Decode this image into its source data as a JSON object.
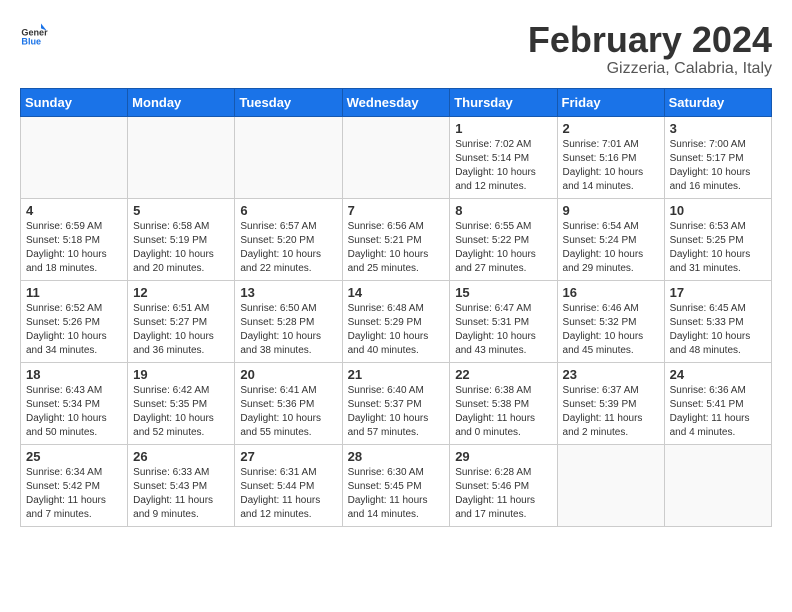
{
  "header": {
    "logo_general": "General",
    "logo_blue": "Blue",
    "title": "February 2024",
    "subtitle": "Gizzeria, Calabria, Italy"
  },
  "columns": [
    "Sunday",
    "Monday",
    "Tuesday",
    "Wednesday",
    "Thursday",
    "Friday",
    "Saturday"
  ],
  "weeks": [
    [
      {
        "day": "",
        "info": ""
      },
      {
        "day": "",
        "info": ""
      },
      {
        "day": "",
        "info": ""
      },
      {
        "day": "",
        "info": ""
      },
      {
        "day": "1",
        "info": "Sunrise: 7:02 AM\nSunset: 5:14 PM\nDaylight: 10 hours\nand 12 minutes."
      },
      {
        "day": "2",
        "info": "Sunrise: 7:01 AM\nSunset: 5:16 PM\nDaylight: 10 hours\nand 14 minutes."
      },
      {
        "day": "3",
        "info": "Sunrise: 7:00 AM\nSunset: 5:17 PM\nDaylight: 10 hours\nand 16 minutes."
      }
    ],
    [
      {
        "day": "4",
        "info": "Sunrise: 6:59 AM\nSunset: 5:18 PM\nDaylight: 10 hours\nand 18 minutes."
      },
      {
        "day": "5",
        "info": "Sunrise: 6:58 AM\nSunset: 5:19 PM\nDaylight: 10 hours\nand 20 minutes."
      },
      {
        "day": "6",
        "info": "Sunrise: 6:57 AM\nSunset: 5:20 PM\nDaylight: 10 hours\nand 22 minutes."
      },
      {
        "day": "7",
        "info": "Sunrise: 6:56 AM\nSunset: 5:21 PM\nDaylight: 10 hours\nand 25 minutes."
      },
      {
        "day": "8",
        "info": "Sunrise: 6:55 AM\nSunset: 5:22 PM\nDaylight: 10 hours\nand 27 minutes."
      },
      {
        "day": "9",
        "info": "Sunrise: 6:54 AM\nSunset: 5:24 PM\nDaylight: 10 hours\nand 29 minutes."
      },
      {
        "day": "10",
        "info": "Sunrise: 6:53 AM\nSunset: 5:25 PM\nDaylight: 10 hours\nand 31 minutes."
      }
    ],
    [
      {
        "day": "11",
        "info": "Sunrise: 6:52 AM\nSunset: 5:26 PM\nDaylight: 10 hours\nand 34 minutes."
      },
      {
        "day": "12",
        "info": "Sunrise: 6:51 AM\nSunset: 5:27 PM\nDaylight: 10 hours\nand 36 minutes."
      },
      {
        "day": "13",
        "info": "Sunrise: 6:50 AM\nSunset: 5:28 PM\nDaylight: 10 hours\nand 38 minutes."
      },
      {
        "day": "14",
        "info": "Sunrise: 6:48 AM\nSunset: 5:29 PM\nDaylight: 10 hours\nand 40 minutes."
      },
      {
        "day": "15",
        "info": "Sunrise: 6:47 AM\nSunset: 5:31 PM\nDaylight: 10 hours\nand 43 minutes."
      },
      {
        "day": "16",
        "info": "Sunrise: 6:46 AM\nSunset: 5:32 PM\nDaylight: 10 hours\nand 45 minutes."
      },
      {
        "day": "17",
        "info": "Sunrise: 6:45 AM\nSunset: 5:33 PM\nDaylight: 10 hours\nand 48 minutes."
      }
    ],
    [
      {
        "day": "18",
        "info": "Sunrise: 6:43 AM\nSunset: 5:34 PM\nDaylight: 10 hours\nand 50 minutes."
      },
      {
        "day": "19",
        "info": "Sunrise: 6:42 AM\nSunset: 5:35 PM\nDaylight: 10 hours\nand 52 minutes."
      },
      {
        "day": "20",
        "info": "Sunrise: 6:41 AM\nSunset: 5:36 PM\nDaylight: 10 hours\nand 55 minutes."
      },
      {
        "day": "21",
        "info": "Sunrise: 6:40 AM\nSunset: 5:37 PM\nDaylight: 10 hours\nand 57 minutes."
      },
      {
        "day": "22",
        "info": "Sunrise: 6:38 AM\nSunset: 5:38 PM\nDaylight: 11 hours\nand 0 minutes."
      },
      {
        "day": "23",
        "info": "Sunrise: 6:37 AM\nSunset: 5:39 PM\nDaylight: 11 hours\nand 2 minutes."
      },
      {
        "day": "24",
        "info": "Sunrise: 6:36 AM\nSunset: 5:41 PM\nDaylight: 11 hours\nand 4 minutes."
      }
    ],
    [
      {
        "day": "25",
        "info": "Sunrise: 6:34 AM\nSunset: 5:42 PM\nDaylight: 11 hours\nand 7 minutes."
      },
      {
        "day": "26",
        "info": "Sunrise: 6:33 AM\nSunset: 5:43 PM\nDaylight: 11 hours\nand 9 minutes."
      },
      {
        "day": "27",
        "info": "Sunrise: 6:31 AM\nSunset: 5:44 PM\nDaylight: 11 hours\nand 12 minutes."
      },
      {
        "day": "28",
        "info": "Sunrise: 6:30 AM\nSunset: 5:45 PM\nDaylight: 11 hours\nand 14 minutes."
      },
      {
        "day": "29",
        "info": "Sunrise: 6:28 AM\nSunset: 5:46 PM\nDaylight: 11 hours\nand 17 minutes."
      },
      {
        "day": "",
        "info": ""
      },
      {
        "day": "",
        "info": ""
      }
    ]
  ]
}
